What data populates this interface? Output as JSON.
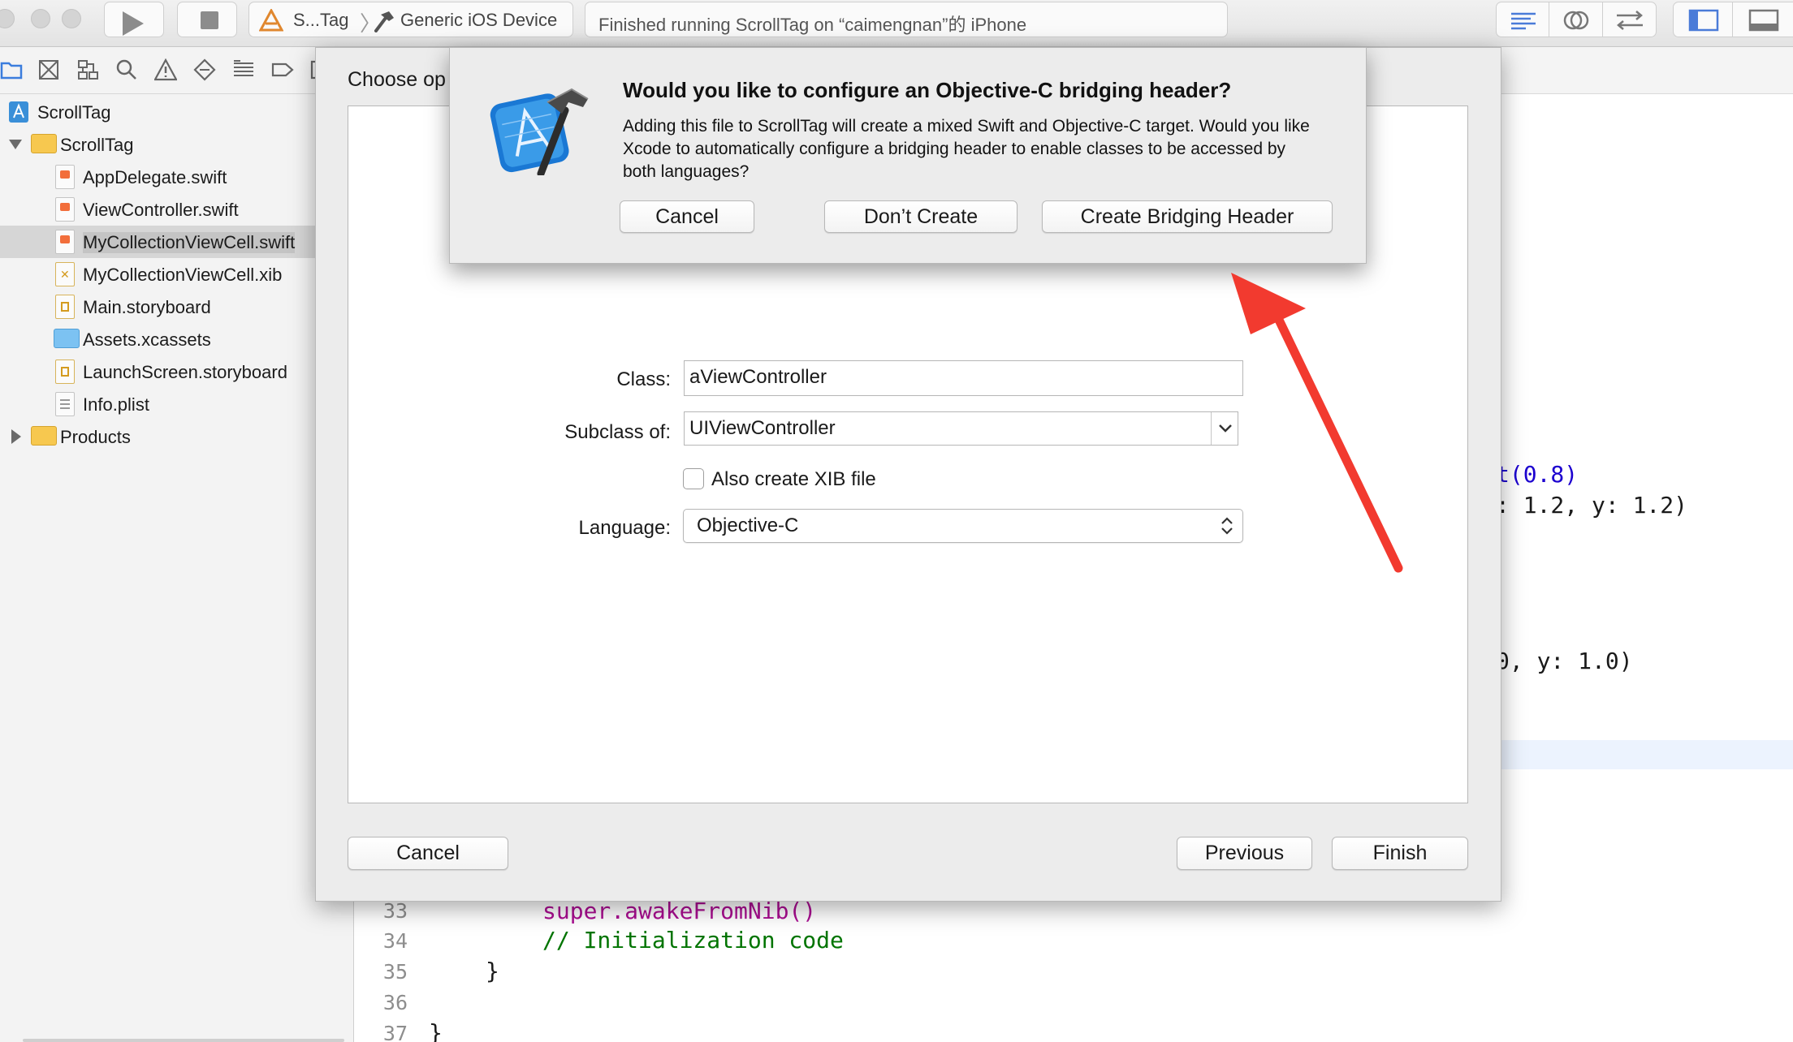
{
  "toolbar": {
    "scheme_target": "S...Tag",
    "scheme_device": "Generic iOS Device",
    "activity_status": "Finished running ScrollTag on “caimengnan”的 iPhone"
  },
  "navigator": {
    "project": "ScrollTag",
    "group": "ScrollTag",
    "files": [
      {
        "label": "AppDelegate.swift"
      },
      {
        "label": "ViewController.swift"
      },
      {
        "label": "MyCollectionViewCell.swift"
      },
      {
        "label": "MyCollectionViewCell.xib"
      },
      {
        "label": "Main.storyboard"
      },
      {
        "label": "Assets.xcassets"
      },
      {
        "label": "LaunchScreen.storyboard"
      },
      {
        "label": "Info.plist"
      }
    ],
    "products": "Products"
  },
  "editor": {
    "frag1": "t(0.8)",
    "frag2": ": 1.2, y: 1.2)",
    "frag3": "0, y: 1.0)",
    "line33_no": "33",
    "line33_code": "super.awakeFromNib()",
    "line34_no": "34",
    "line34_code": "// Initialization code",
    "line35_no": "35",
    "line35_code": "}",
    "line36_no": "36",
    "line37_no": "37",
    "line37_code": "}"
  },
  "sheet": {
    "title": "Choose op",
    "class_label": "Class:",
    "class_value": "aViewController",
    "subclass_label": "Subclass of:",
    "subclass_value": "UIViewController",
    "xib_label": "Also create XIB file",
    "language_label": "Language:",
    "language_value": "Objective-C",
    "cancel": "Cancel",
    "previous": "Previous",
    "finish": "Finish"
  },
  "alert": {
    "title": "Would you like to configure an Objective-C bridging header?",
    "message": "Adding this file to ScrollTag will create a mixed Swift and Objective-C target. Would you like Xcode to automatically configure a bridging header to enable classes to be accessed by both languages?",
    "cancel": "Cancel",
    "dont_create": "Don’t Create",
    "create": "Create Bridging Header"
  },
  "colors": {
    "annotation_arrow": "#f23a2f",
    "swift_keyword": "#aa0d91",
    "number": "#1c00cf",
    "comment": "#007400"
  }
}
